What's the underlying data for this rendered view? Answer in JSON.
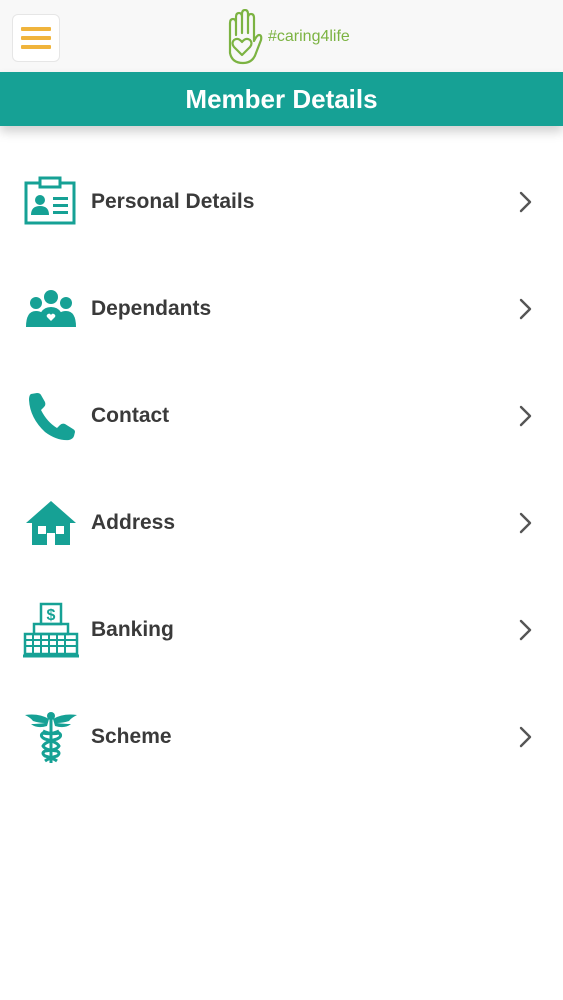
{
  "header": {
    "menu_icon": "hamburger-icon",
    "logo_text": "#caring4life",
    "logo_icon": "hand-heart-icon",
    "accent_color": "#f0b43c",
    "logo_color": "#7cb342"
  },
  "title_bar": {
    "title": "Member Details",
    "color": "#16a195"
  },
  "menu": {
    "items": [
      {
        "label": "Personal Details",
        "icon": "id-card-icon"
      },
      {
        "label": "Dependants",
        "icon": "people-group-icon"
      },
      {
        "label": "Contact",
        "icon": "phone-icon"
      },
      {
        "label": "Address",
        "icon": "house-icon"
      },
      {
        "label": "Banking",
        "icon": "bank-building-icon"
      },
      {
        "label": "Scheme",
        "icon": "caduceus-icon"
      }
    ],
    "chevron_icon": "chevron-right-icon",
    "icon_color": "#16a195"
  }
}
